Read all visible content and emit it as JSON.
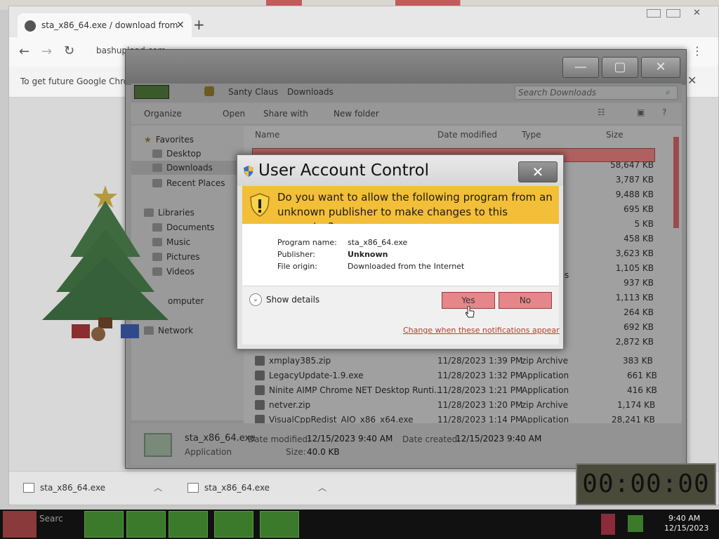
{
  "chrome": {
    "tab_title": "sta_x86_64.exe / download from",
    "new_tab": "+",
    "address": "bashupload.com",
    "infobar_text": "To get future Google Chro",
    "downloads": [
      {
        "name": "sta_x86_64.exe"
      },
      {
        "name": "sta_x86_64.exe"
      }
    ]
  },
  "explorer": {
    "breadcrumb": [
      "Santy Claus",
      "Downloads"
    ],
    "search_placeholder": "Search Downloads",
    "commands": [
      "Organize",
      "Open",
      "Share with",
      "New folder"
    ],
    "nav": {
      "favorites": "Favorites",
      "desktop": "Desktop",
      "downloads": "Downloads",
      "recent": "Recent Places",
      "libraries": "Libraries",
      "documents": "Documents",
      "music": "Music",
      "pictures": "Pictures",
      "videos": "Videos",
      "computer": "omputer",
      "network": "Network"
    },
    "columns": {
      "name": "Name",
      "date": "Date modified",
      "type": "Type",
      "size": "Size"
    },
    "sizes_partial": [
      "58,647 KB",
      "3,787 KB",
      "9,488 KB",
      "695 KB",
      "5 KB",
      "458 KB",
      "3,623 KB",
      "1,105 KB",
      "937 KB",
      "1,113 KB",
      "264 KB",
      "692 KB",
      "2,872 KB"
    ],
    "partial_type": "h Entries",
    "files": [
      {
        "name": "xmplay385.zip",
        "date": "11/28/2023 1:39 PM",
        "type": "zip Archive",
        "size": "383 KB"
      },
      {
        "name": "LegacyUpdate-1.9.exe",
        "date": "11/28/2023 1:32 PM",
        "type": "Application",
        "size": "661 KB"
      },
      {
        "name": "Ninite AIMP Chrome NET Desktop Runti...",
        "date": "11/28/2023 1:21 PM",
        "type": "Application",
        "size": "416 KB"
      },
      {
        "name": "netver.zip",
        "date": "11/28/2023 1:20 PM",
        "type": "zip Archive",
        "size": "1,174 KB"
      },
      {
        "name": "VisualCppRedist_AIO_x86_x64.exe",
        "date": "11/28/2023 1:14 PM",
        "type": "Application",
        "size": "28,241 KB"
      }
    ],
    "details": {
      "filename": "sta_x86_64.exe",
      "filetype": "Application",
      "modified_label": "Date modified:",
      "modified_value": "12/15/2023 9:40 AM",
      "created_label": "Date created:",
      "created_value": "12/15/2023 9:40 AM",
      "size_label": "Size:",
      "size_value": "40.0 KB"
    }
  },
  "uac": {
    "title": "User Account Control",
    "close": "✕",
    "question": "Do you want to allow the following program from an unknown publisher to make changes to this computer?",
    "program_label": "Program name:",
    "program_value": "sta_x86_64.exe",
    "publisher_label": "Publisher:",
    "publisher_value": "Unknown",
    "origin_label": "File origin:",
    "origin_value": "Downloaded from the Internet",
    "show_details": "Show details",
    "yes": "Yes",
    "no": "No",
    "change_link": "Change when these notifications appear"
  },
  "timer": "00:00:00",
  "taskbar": {
    "search_partial": "Searc",
    "tray_time": "9:40 AM",
    "tray_date": "12/15/2023"
  },
  "colors": {
    "uac_banner": "#f3bf38",
    "button_highlight": "#e4868a",
    "taskbar_green": "#3b7a2a"
  }
}
